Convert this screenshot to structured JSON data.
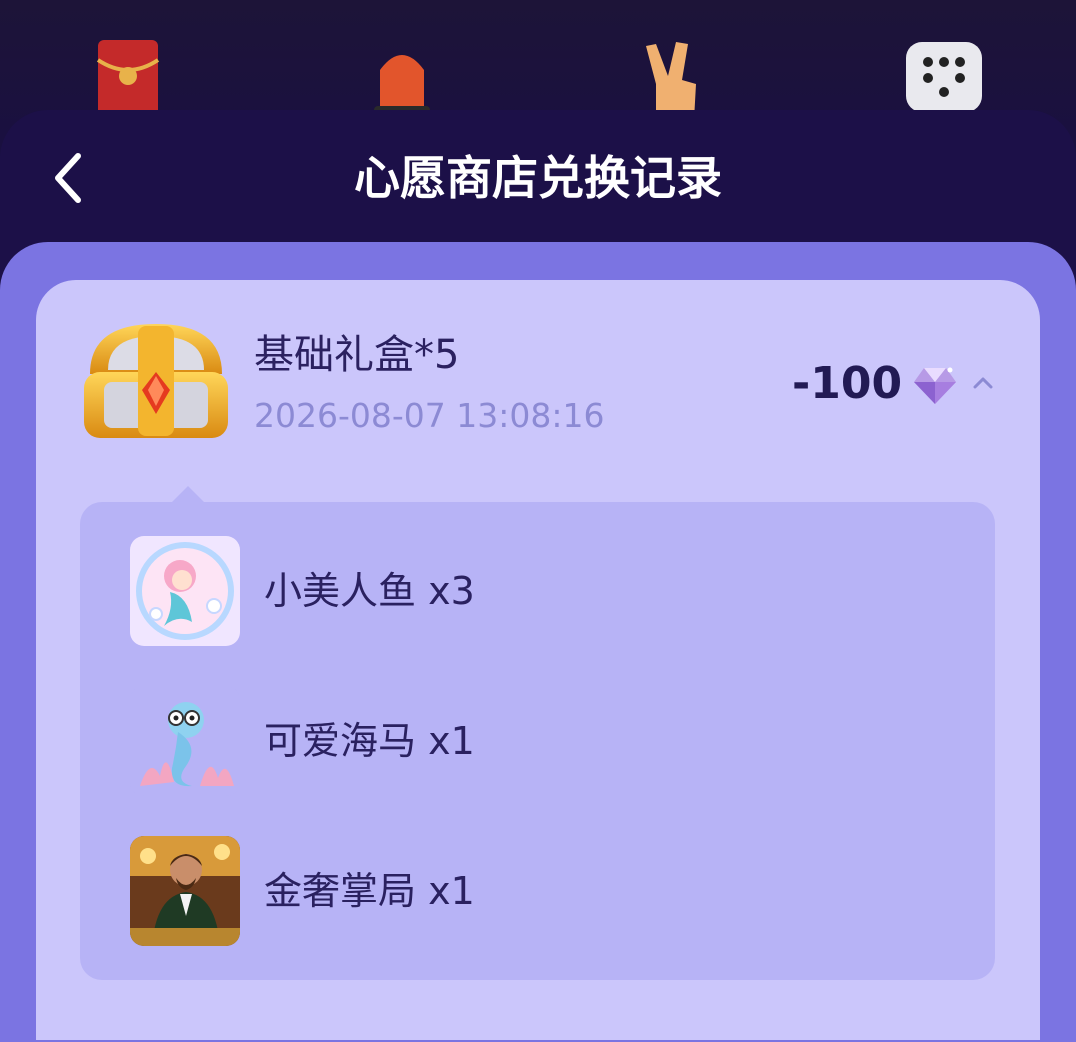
{
  "header": {
    "title": "心愿商店兑换记录"
  },
  "record": {
    "item_name": "基础礼盒*5",
    "timestamp": "2026-08-07 13:08:16",
    "cost": "-100",
    "expanded": true,
    "rewards": [
      {
        "label": "小美人鱼 x3",
        "icon": "mermaid-gift-icon"
      },
      {
        "label": "可爱海马 x1",
        "icon": "seahorse-gift-icon"
      },
      {
        "label": "金奢掌局 x1",
        "icon": "tycoon-gift-icon"
      }
    ]
  },
  "colors": {
    "sheet_bg": "#1c1048",
    "panel_bg": "#7b74e2",
    "card_bg": "#cbc6fb",
    "detail_bg": "#b7b3f6",
    "text_dark": "#221a54",
    "date_text": "#8c8ad4"
  }
}
